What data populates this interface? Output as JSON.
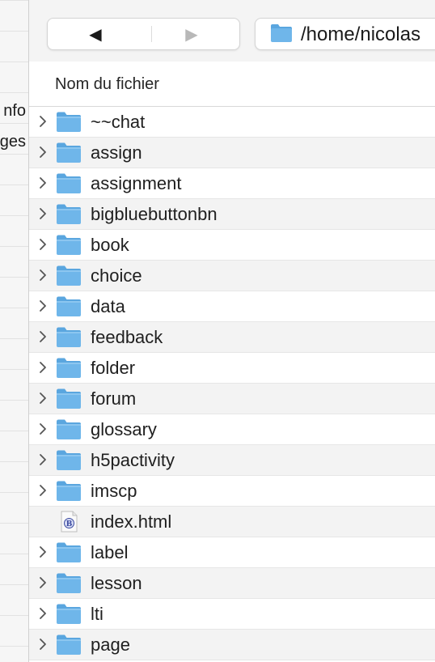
{
  "background_window": {
    "labels": [
      "nfo",
      "ges"
    ]
  },
  "toolbar": {
    "back_glyph": "◀",
    "forward_glyph": "▶",
    "path": "/home/nicolas"
  },
  "columns": {
    "name_header": "Nom du fichier"
  },
  "colors": {
    "folder_blue": "#6fb6ea",
    "row_alt": "#f3f3f3"
  },
  "files": [
    {
      "name": "~~chat",
      "type": "folder",
      "icon": "folder-icon"
    },
    {
      "name": "assign",
      "type": "folder",
      "icon": "folder-icon"
    },
    {
      "name": "assignment",
      "type": "folder",
      "icon": "folder-icon"
    },
    {
      "name": "bigbluebuttonbn",
      "type": "folder",
      "icon": "folder-icon"
    },
    {
      "name": "book",
      "type": "folder",
      "icon": "folder-icon"
    },
    {
      "name": "choice",
      "type": "folder",
      "icon": "folder-icon"
    },
    {
      "name": "data",
      "type": "folder",
      "icon": "folder-icon"
    },
    {
      "name": "feedback",
      "type": "folder",
      "icon": "folder-icon"
    },
    {
      "name": "folder",
      "type": "folder",
      "icon": "folder-icon"
    },
    {
      "name": "forum",
      "type": "folder",
      "icon": "folder-icon"
    },
    {
      "name": "glossary",
      "type": "folder",
      "icon": "folder-icon"
    },
    {
      "name": "h5pactivity",
      "type": "folder",
      "icon": "folder-icon"
    },
    {
      "name": "imscp",
      "type": "folder",
      "icon": "folder-icon"
    },
    {
      "name": "index.html",
      "type": "file",
      "icon": "html-file-icon"
    },
    {
      "name": "label",
      "type": "folder",
      "icon": "folder-icon"
    },
    {
      "name": "lesson",
      "type": "folder",
      "icon": "folder-icon"
    },
    {
      "name": "lti",
      "type": "folder",
      "icon": "folder-icon"
    },
    {
      "name": "page",
      "type": "folder",
      "icon": "folder-icon"
    }
  ]
}
